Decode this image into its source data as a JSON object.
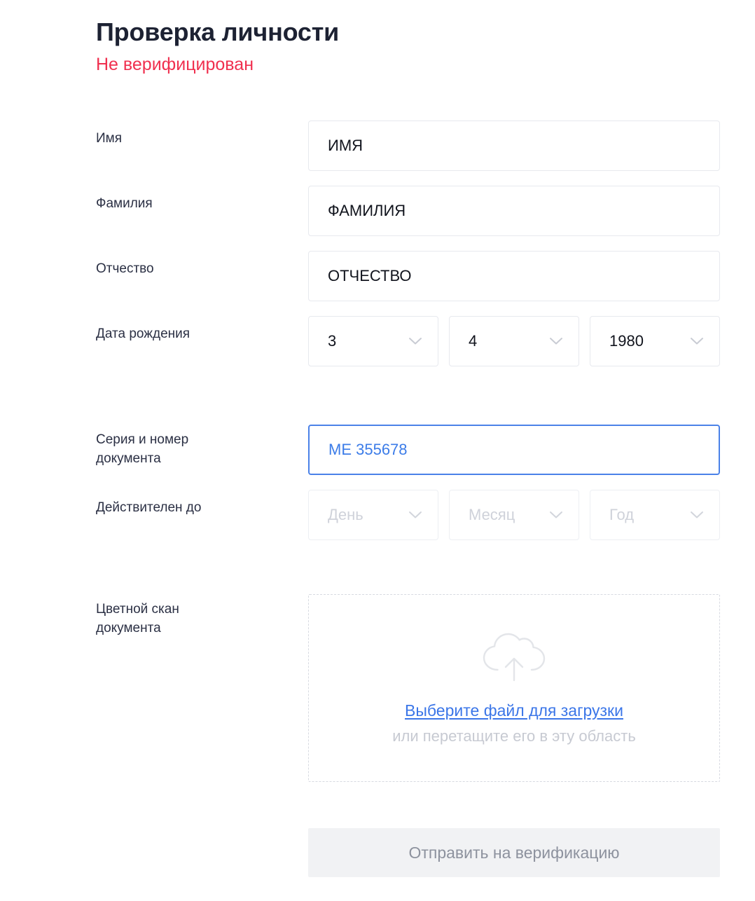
{
  "header": {
    "title": "Проверка личности",
    "status": "Не верифицирован",
    "status_color": "#f0304f",
    "title_color": "#1d2233"
  },
  "theme": {
    "accent_blue": "#3b76e8",
    "focus_border": "#4b82e8",
    "border_gray": "#e7e9ee",
    "placeholder_gray": "#cfd2da",
    "disabled_button_bg": "#f1f2f4",
    "disabled_button_text": "#8d929e"
  },
  "form": {
    "first_name": {
      "label": "Имя",
      "value": "ИМЯ",
      "placeholder": "Имя"
    },
    "last_name": {
      "label": "Фамилия",
      "value": "ФАМИЛИЯ",
      "placeholder": "Фамилия"
    },
    "middle_name": {
      "label": "Отчество",
      "value": "ОТЧЕСТВО",
      "placeholder": "Отчество"
    },
    "birth_date": {
      "label": "Дата рождения",
      "day": "3",
      "month": "4",
      "year": "1980"
    },
    "document_number": {
      "label_line1": "Серия и номер",
      "label_line2": "документа",
      "value": "МЕ 355678",
      "focused": true
    },
    "valid_until": {
      "label": "Действителен до",
      "day_placeholder": "День",
      "month_placeholder": "Месяц",
      "year_placeholder": "Год"
    },
    "document_scan": {
      "label_line1": "Цветной скан",
      "label_line2": "документа",
      "link": "Выберите файл для загрузки",
      "hint": "или перетащите его в эту область"
    },
    "submit": {
      "label": "Отправить на верификацию",
      "disabled": true
    }
  },
  "icons": {
    "chevron": "chevron-down-icon",
    "cloud": "cloud-upload-icon"
  }
}
